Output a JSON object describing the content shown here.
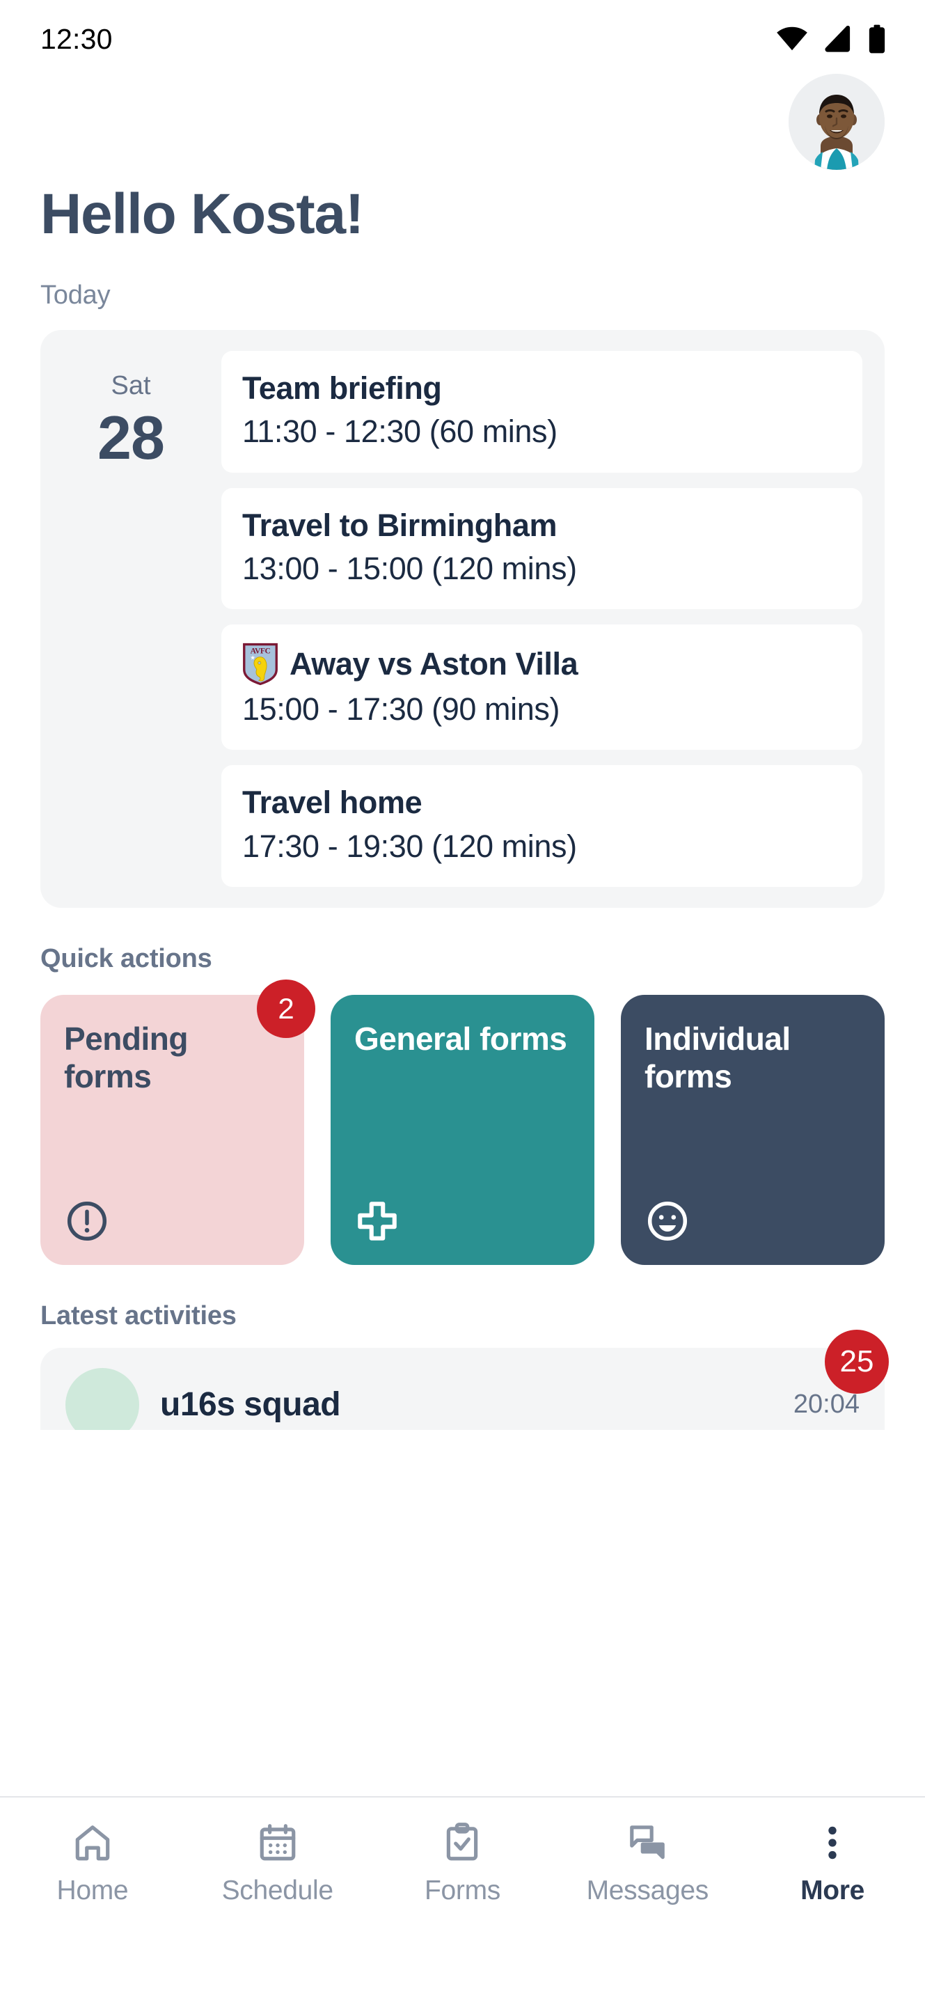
{
  "status_bar": {
    "time": "12:30",
    "icons": [
      "wifi-icon",
      "cellular-signal-icon",
      "battery-icon"
    ]
  },
  "header": {
    "avatar_name": "user-avatar",
    "greeting": "Hello Kosta!"
  },
  "today": {
    "label": "Today",
    "date": {
      "day_of_week": "Sat",
      "day_number": "28"
    },
    "events": [
      {
        "title": "Team briefing",
        "time": "11:30 - 12:30 (60 mins)",
        "crest": null
      },
      {
        "title": "Travel to Birmingham",
        "time": "13:00 - 15:00 (120 mins)",
        "crest": null
      },
      {
        "title": "Away vs Aston Villa",
        "time": "15:00 - 17:30 (90 mins)",
        "crest": "aston-villa-crest"
      },
      {
        "title": "Travel home",
        "time": "17:30 - 19:30 (120 mins)",
        "crest": null
      }
    ]
  },
  "quick_actions": {
    "label": "Quick actions",
    "cards": [
      {
        "label": "Pending forms",
        "badge": "2",
        "icon": "alert-circle-icon",
        "bg": "#f3d4d6",
        "fg": "#3c4c63"
      },
      {
        "label": "General forms",
        "badge": null,
        "icon": "plus-cross-icon",
        "bg": "#2a9191",
        "fg": "#ffffff"
      },
      {
        "label": "Individual forms",
        "badge": null,
        "icon": "smiley-face-icon",
        "bg": "#3c4c63",
        "fg": "#ffffff"
      }
    ]
  },
  "latest_activities": {
    "label": "Latest activities",
    "badge": "25",
    "items": [
      {
        "title": "u16s squad",
        "time": "20:04"
      }
    ]
  },
  "bottom_nav": {
    "items": [
      {
        "label": "Home",
        "icon": "home-icon",
        "active": false
      },
      {
        "label": "Schedule",
        "icon": "calendar-icon",
        "active": false
      },
      {
        "label": "Forms",
        "icon": "clipboard-check-icon",
        "active": false
      },
      {
        "label": "Messages",
        "icon": "chat-bubbles-icon",
        "active": false
      },
      {
        "label": "More",
        "icon": "more-vertical-icon",
        "active": true
      }
    ]
  },
  "colors": {
    "navy": "#3c4c63",
    "dark_text": "#1b2a41",
    "muted": "#67748a",
    "teal": "#2a9191",
    "pink": "#f3d4d6",
    "red_badge": "#cc2028",
    "card_bg": "#f4f5f6"
  }
}
